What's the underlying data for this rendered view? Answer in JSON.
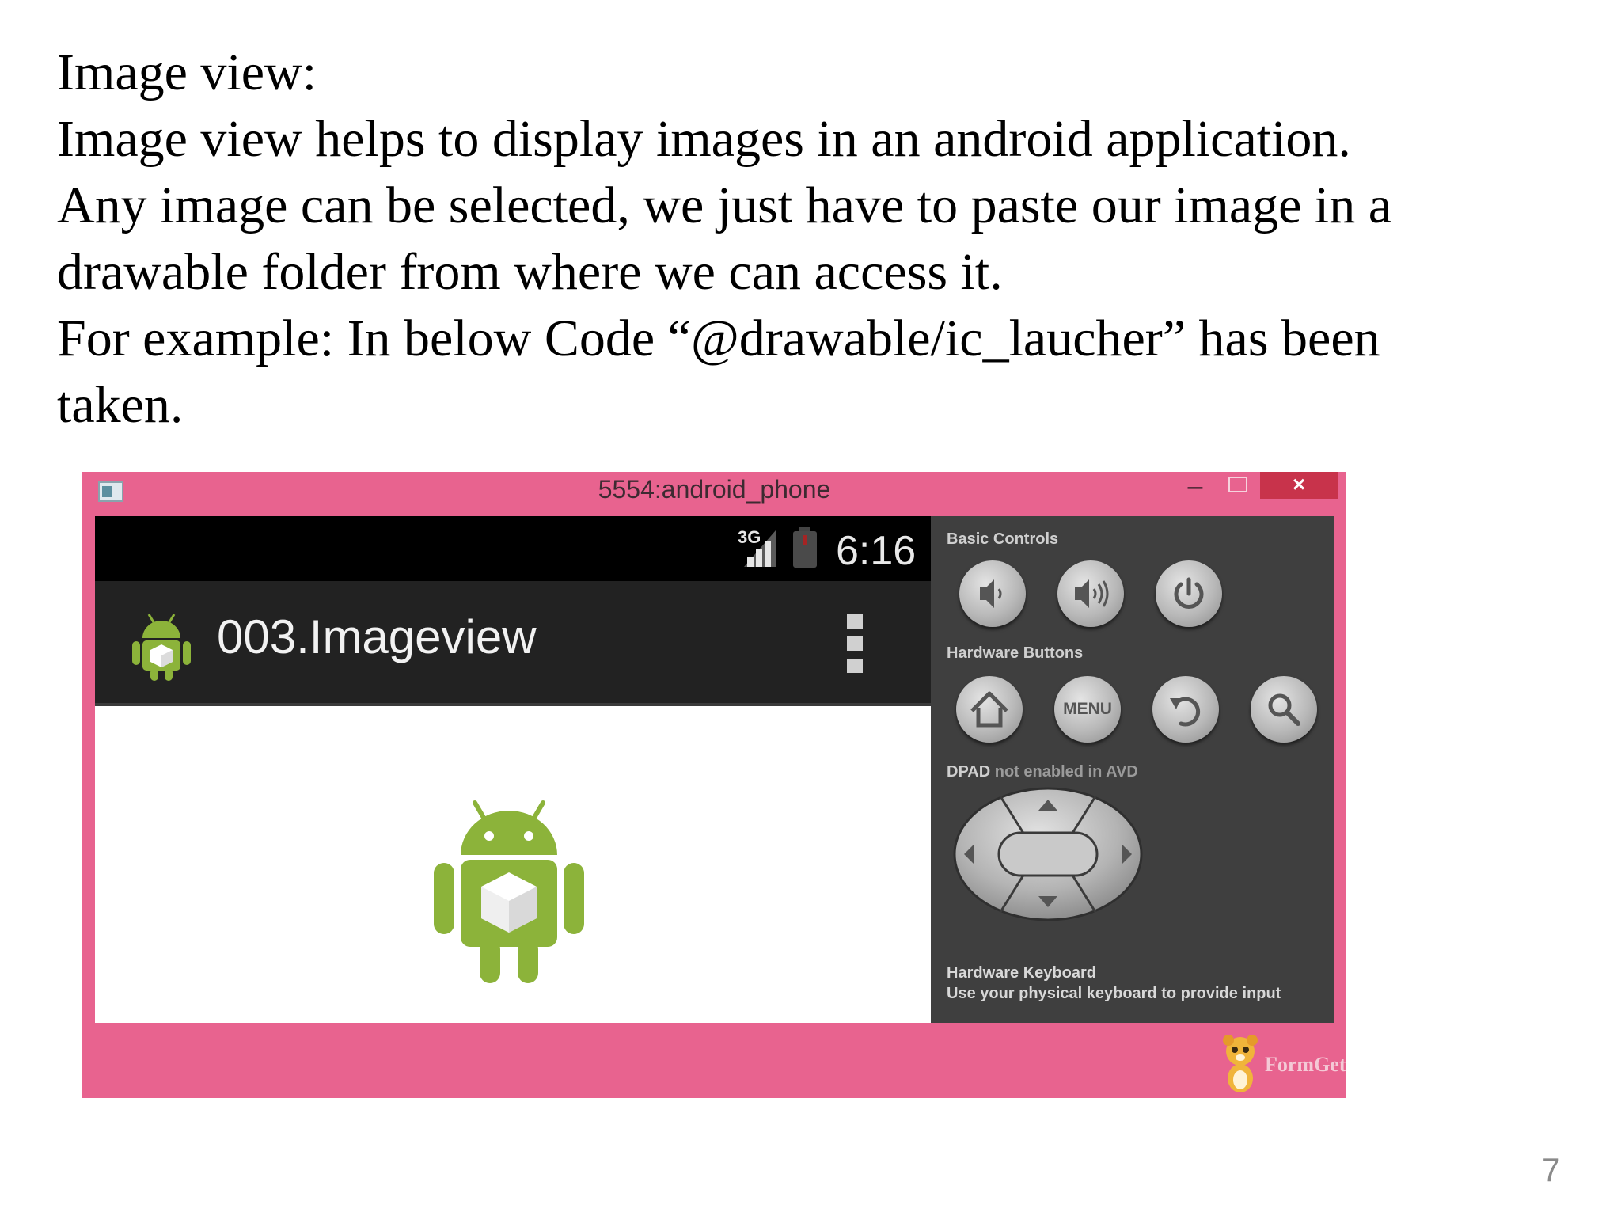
{
  "slide": {
    "heading": "Image view:",
    "lines": [
      "Image view helps to display images in an android application.",
      "Any image can be selected, we just have to paste our image in a",
      "drawable folder from where we can access it.",
      "For example: In below Code “@drawable/ic_laucher” has been",
      "taken."
    ],
    "page_number": "7"
  },
  "emulator": {
    "window_title": "5554:android_phone",
    "minimize_glyph": "–",
    "close_glyph": "×",
    "status_bar": {
      "network": "3G",
      "time": "6:16"
    },
    "app_title": "003.Imageview",
    "controls": {
      "basic_controls_label": "Basic Controls",
      "hardware_buttons_label": "Hardware Buttons",
      "menu_label": "MENU",
      "dpad_label_bold": "DPAD",
      "dpad_label_rest": " not enabled in AVD",
      "keyboard_title": "Hardware Keyboard",
      "keyboard_desc": "Use your physical keyboard to provide input"
    },
    "brand": "FormGet"
  },
  "colors": {
    "window_frame": "#e8638f",
    "close_button": "#c8334b",
    "android_green": "#8cb33a"
  },
  "icons": [
    "window-icon",
    "signal-icon",
    "battery-icon",
    "android-app-icon",
    "overflow-menu-icon",
    "volume-down-icon",
    "volume-up-icon",
    "power-icon",
    "home-icon",
    "back-icon",
    "search-icon",
    "dpad-icon",
    "android-robot-image",
    "formget-mascot-icon"
  ]
}
